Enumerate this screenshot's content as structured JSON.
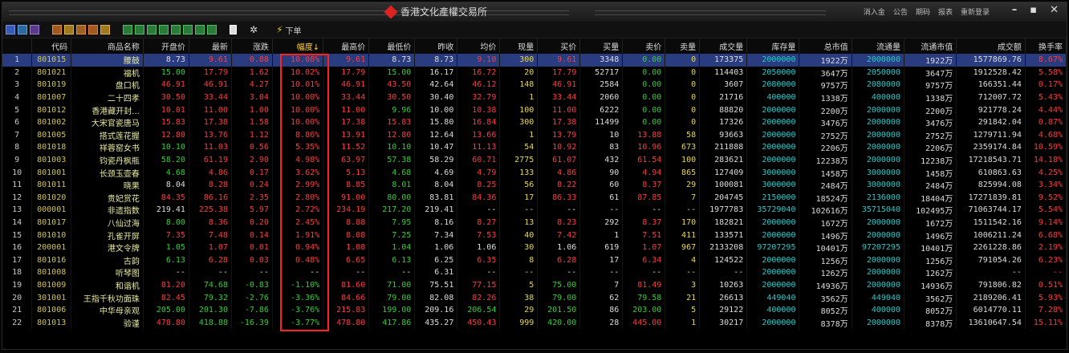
{
  "title": "香港文化產權交易所",
  "title_menu": [
    "消入金",
    "公告",
    "期码",
    "报表",
    "重新登录"
  ],
  "window_controls": [
    "–",
    "▪",
    "✕"
  ],
  "toolbar": {
    "order_label": "下单"
  },
  "colors": {
    "up": "#ff3b3b",
    "down": "#2ed22e",
    "flat": "#dcdcdc",
    "selected_row": "#2a3c80",
    "highlight_box": "#ff2020",
    "volume": "#28c8c8"
  },
  "columns": [
    "",
    "代码",
    "商品名称",
    "开盘价",
    "最新",
    "涨跌",
    "幅度↓",
    "最高价",
    "最低价",
    "昨收",
    "均价",
    "现量",
    "买价",
    "买量",
    "卖价",
    "卖量",
    "成交量",
    "库存量",
    "总市值",
    "流通量",
    "流通市值",
    "成交额",
    "换手率"
  ],
  "rows": [
    [
      "1",
      "801015",
      "腰鼓",
      "8.73",
      "9.61",
      "0.88",
      "10.08%",
      "9.61",
      "8.73",
      "8.73",
      "9.10",
      "300",
      "9.61",
      "3348",
      "0.00",
      "0",
      "173375",
      "2000000",
      "1922万",
      "2000000",
      "1922万",
      "1577869.76",
      "8.67%"
    ],
    [
      "2",
      "801021",
      "福机",
      "15.00",
      "17.79",
      "1.62",
      "10.02%",
      "17.79",
      "15.00",
      "16.17",
      "16.72",
      "20",
      "17.79",
      "52717",
      "0.00",
      "0",
      "114403",
      "2050000",
      "3647万",
      "2050000",
      "3647万",
      "1912528.42",
      "5.58%"
    ],
    [
      "3",
      "801019",
      "盘口机",
      "46.91",
      "46.91",
      "4.27",
      "10.01%",
      "46.91",
      "43.50",
      "42.64",
      "46.12",
      "148",
      "46.91",
      "2584",
      "0.00",
      "0",
      "3607",
      "2080000",
      "9757万",
      "2080000",
      "9757万",
      "166351.44",
      "0.17%"
    ],
    [
      "4",
      "801007",
      "二十四孝",
      "30.50",
      "33.44",
      "3.04",
      "10.00%",
      "33.44",
      "30.50",
      "30.40",
      "32.79",
      "1",
      "33.44",
      "2060",
      "0.00",
      "0",
      "21716",
      "400000",
      "1338万",
      "400000",
      "1338万",
      "712007.72",
      "5.43%"
    ],
    [
      "5",
      "801012",
      "香港藏开封...",
      "10.01",
      "11.00",
      "1.00",
      "10.00%",
      "11.00",
      "9.96",
      "10.00",
      "10.38",
      "100",
      "11.00",
      "6222",
      "0.00",
      "0",
      "88820",
      "2000000",
      "2200万",
      "2000000",
      "2200万",
      "921778.24",
      "4.44%"
    ],
    [
      "6",
      "801002",
      "大宋官瓷唐马",
      "15.83",
      "17.38",
      "1.58",
      "10.00%",
      "17.38",
      "15.83",
      "15.80",
      "16.84",
      "300",
      "17.38",
      "11499",
      "0.00",
      "0",
      "17326",
      "2000000",
      "3476万",
      "2000000",
      "3476万",
      "291842.04",
      "0.87%"
    ],
    [
      "7",
      "801005",
      "搭式莲花握",
      "12.80",
      "13.76",
      "1.12",
      "8.86%",
      "13.91",
      "12.80",
      "12.64",
      "13.66",
      "1",
      "13.79",
      "10",
      "13.88",
      "58",
      "93663",
      "2000000",
      "2752万",
      "2000000",
      "2752万",
      "1279711.94",
      "4.68%"
    ],
    [
      "8",
      "801018",
      "祥蓉窑女书",
      "10.10",
      "11.03",
      "0.56",
      "5.35%",
      "11.52",
      "10.10",
      "10.47",
      "11.13",
      "54",
      "10.92",
      "83",
      "10.96",
      "673",
      "211888",
      "2000000",
      "2206万",
      "2000000",
      "2206万",
      "2359174.84",
      "10.59%"
    ],
    [
      "9",
      "801003",
      "钧瓷丹枫瓶",
      "58.20",
      "61.19",
      "2.90",
      "4.98%",
      "63.97",
      "57.38",
      "58.29",
      "60.71",
      "2775",
      "61.07",
      "432",
      "61.54",
      "100",
      "283621",
      "2000000",
      "12238万",
      "2000000",
      "12238万",
      "17218543.71",
      "14.18%"
    ],
    [
      "10",
      "801001",
      "长颈玉壶春",
      "4.68",
      "4.86",
      "0.17",
      "3.62%",
      "5.13",
      "4.68",
      "4.69",
      "4.79",
      "133",
      "4.86",
      "90",
      "4.94",
      "865",
      "127409",
      "3000000",
      "1458万",
      "3000000",
      "1458万",
      "610863.63",
      "4.25%"
    ],
    [
      "11",
      "801011",
      "晓果",
      "8.04",
      "8.28",
      "0.24",
      "2.99%",
      "8.85",
      "8.01",
      "8.04",
      "8.25",
      "56",
      "8.22",
      "60",
      "8.37",
      "29",
      "100081",
      "3000000",
      "2484万",
      "3000000",
      "2484万",
      "825994.08",
      "3.34%"
    ],
    [
      "12",
      "801020",
      "贵妃赏花",
      "84.35",
      "86.16",
      "2.35",
      "2.80%",
      "91.00",
      "80.00",
      "83.81",
      "84.36",
      "17",
      "86.33",
      "61",
      "87.85",
      "7",
      "204745",
      "2150000",
      "18524万",
      "2136000",
      "18404万",
      "17271839.81",
      "9.52%"
    ],
    [
      "13",
      "000001",
      "非遗指数",
      "219.41",
      "225.38",
      "5.97",
      "2.72%",
      "234.19",
      "217.20",
      "219.41",
      "--",
      "--",
      "--",
      "--",
      "--",
      "--",
      "1977783",
      "35729040",
      "102616万",
      "35715040",
      "102495万",
      "71063744.17",
      "5.54%"
    ],
    [
      "14",
      "801017",
      "八仙过海",
      "8.00",
      "8.36",
      "0.20",
      "2.45%",
      "8.88",
      "7.95",
      "8.16",
      "8.27",
      "13",
      "8.23",
      "292",
      "8.37",
      "170",
      "182821",
      "2000000",
      "1672万",
      "2000000",
      "1672万",
      "1511542.16",
      "9.14%"
    ],
    [
      "15",
      "801010",
      "孔雀开屏",
      "7.35",
      "7.48",
      "0.14",
      "1.91%",
      "8.08",
      "7.25",
      "7.34",
      "7.53",
      "40",
      "7.42",
      "1",
      "7.51",
      "411",
      "133571",
      "2000000",
      "1496万",
      "2000000",
      "1496万",
      "1006211.24",
      "6.68%"
    ],
    [
      "16",
      "200001",
      "港文令牌",
      "1.05",
      "1.07",
      "0.01",
      "0.94%",
      "1.08",
      "1.04",
      "1.06",
      "1.06",
      "30",
      "1.06",
      "619",
      "1.07",
      "967",
      "2133208",
      "97207295",
      "10401万",
      "97207295",
      "10401万",
      "2261228.86",
      "2.19%"
    ],
    [
      "17",
      "801016",
      "古韵",
      "6.13",
      "6.28",
      "0.03",
      "0.48%",
      "6.65",
      "6.13",
      "6.25",
      "6.35",
      "8",
      "6.28",
      "17",
      "6.34",
      "4",
      "124522",
      "2000000",
      "1256万",
      "2000000",
      "1256万",
      "791054.26",
      "6.23%"
    ],
    [
      "18",
      "801008",
      "听琴图",
      "--",
      "--",
      "--",
      "--",
      "--",
      "--",
      "6.31",
      "--",
      "--",
      "--",
      "--",
      "--",
      "--",
      "--",
      "2000000",
      "1262万",
      "2000000",
      "1262万",
      "--",
      "--"
    ],
    [
      "19",
      "801009",
      "和谐机",
      "81.20",
      "74.68",
      "-0.83",
      "-1.10%",
      "81.60",
      "71.00",
      "75.51",
      "77.15",
      "5",
      "75.00",
      "7",
      "81.49",
      "3",
      "10263",
      "2000000",
      "14936万",
      "2000000",
      "14936万",
      "791806.82",
      "0.51%"
    ],
    [
      "20",
      "301001",
      "王指千秋功面珠",
      "82.45",
      "79.32",
      "-2.76",
      "-3.36%",
      "84.66",
      "79.00",
      "82.08",
      "82.26",
      "38",
      "79.00",
      "62",
      "79.58",
      "21",
      "26613",
      "449040",
      "3562万",
      "449040",
      "3562万",
      "2189206.41",
      "5.93%"
    ],
    [
      "21",
      "801006",
      "中华母亲观",
      "205.00",
      "201.30",
      "-7.86",
      "-3.76%",
      "215.83",
      "199.00",
      "209.16",
      "206.54",
      "29",
      "201.50",
      "86",
      "203.00",
      "5",
      "29122",
      "400000",
      "8052万",
      "400000",
      "8052万",
      "6014770.11",
      "7.28%"
    ],
    [
      "22",
      "801013",
      "验谨",
      "478.80",
      "418.88",
      "-16.39",
      "-3.77%",
      "478.80",
      "417.86",
      "435.27",
      "450.43",
      "999",
      "420.00",
      "28",
      "445.00",
      "1",
      "30217",
      "2000000",
      "8378万",
      "2000000",
      "8378万",
      "13610647.54",
      "15.11%"
    ]
  ]
}
